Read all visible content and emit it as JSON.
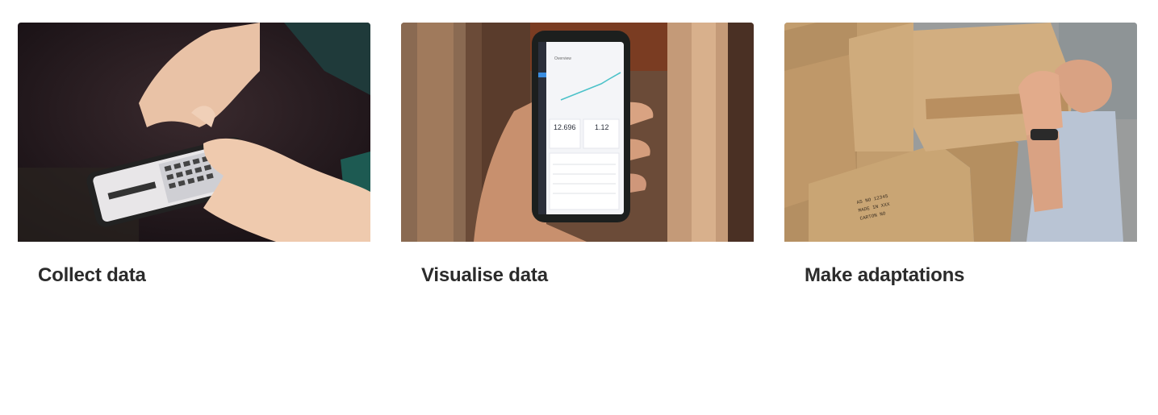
{
  "cards": [
    {
      "title": "Collect data",
      "image": "photo-hands-typing-on-smartphone"
    },
    {
      "title": "Visualise data",
      "image": "photo-hand-holding-phone-with-dashboard"
    },
    {
      "title": "Make adaptations",
      "image": "photo-man-lifting-cardboard-boxes"
    }
  ],
  "phone_dashboard": {
    "header": "Overview",
    "stat_1": "12.696",
    "stat_2": "1.12"
  },
  "colors": {
    "title_text": "#2b2b2b",
    "background": "#ffffff",
    "dashboard_line": "#4cc2c9"
  }
}
